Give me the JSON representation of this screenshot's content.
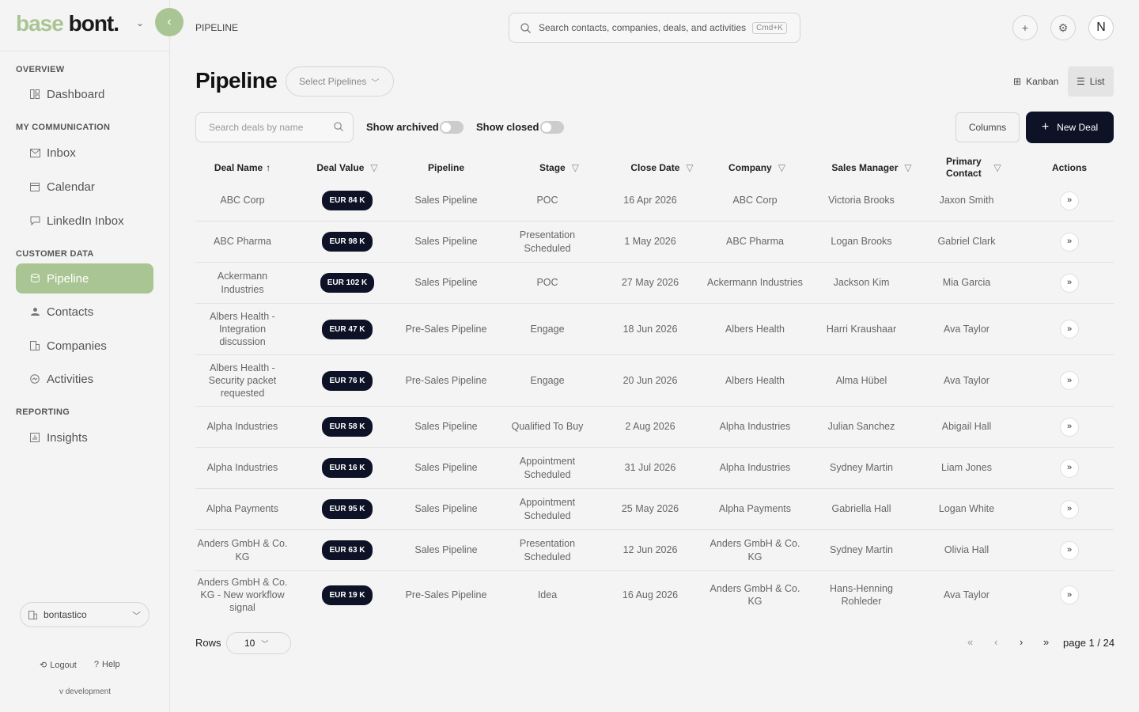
{
  "logo": {
    "part1": "base",
    "part2": "bont."
  },
  "breadcrumb": "PIPELINE",
  "top_search": {
    "placeholder": "Search contacts, companies, deals, and activities",
    "shortcut": "Cmd+K"
  },
  "user_initial": "N",
  "sidebar": {
    "sections": [
      {
        "title": "OVERVIEW",
        "items": [
          {
            "label": "Dashboard",
            "icon": "dashboard-icon"
          }
        ]
      },
      {
        "title": "MY COMMUNICATION",
        "items": [
          {
            "label": "Inbox",
            "icon": "mail-icon"
          },
          {
            "label": "Calendar",
            "icon": "calendar-icon"
          },
          {
            "label": "LinkedIn Inbox",
            "icon": "chat-icon"
          }
        ]
      },
      {
        "title": "CUSTOMER DATA",
        "items": [
          {
            "label": "Pipeline",
            "icon": "database-icon",
            "active": true
          },
          {
            "label": "Contacts",
            "icon": "people-icon"
          },
          {
            "label": "Companies",
            "icon": "building-icon"
          },
          {
            "label": "Activities",
            "icon": "activity-icon"
          }
        ]
      },
      {
        "title": "REPORTING",
        "items": [
          {
            "label": "Insights",
            "icon": "chart-icon"
          }
        ]
      }
    ],
    "workspace": "bontastico",
    "logout": "Logout",
    "help": "Help",
    "version": "v development"
  },
  "page": {
    "title": "Pipeline",
    "select_pipelines": "Select Pipelines",
    "views": {
      "kanban": "Kanban",
      "list": "List",
      "active": "List"
    }
  },
  "filters": {
    "search_placeholder": "Search deals by name",
    "show_archived": "Show archived",
    "show_closed": "Show closed",
    "columns": "Columns",
    "new_deal": "New Deal"
  },
  "table": {
    "headers": [
      "Deal Name",
      "Deal Value",
      "Pipeline",
      "Stage",
      "Close Date",
      "Company",
      "Sales Manager",
      "Primary Contact",
      "Actions"
    ],
    "rows": [
      {
        "name": "ABC Corp",
        "value": "EUR 84 K",
        "pipeline": "Sales Pipeline",
        "stage": "POC",
        "close": "16 Apr 2026",
        "company": "ABC Corp",
        "manager": "Victoria Brooks",
        "contact": "Jaxon Smith"
      },
      {
        "name": "ABC Pharma",
        "value": "EUR 98 K",
        "pipeline": "Sales Pipeline",
        "stage": "Presentation Scheduled",
        "close": "1 May 2026",
        "company": "ABC Pharma",
        "manager": "Logan Brooks",
        "contact": "Gabriel Clark"
      },
      {
        "name": "Ackermann Industries",
        "value": "EUR 102 K",
        "pipeline": "Sales Pipeline",
        "stage": "POC",
        "close": "27 May 2026",
        "company": "Ackermann Industries",
        "manager": "Jackson Kim",
        "contact": "Mia Garcia"
      },
      {
        "name": "Albers Health - Integration discussion",
        "value": "EUR 47 K",
        "pipeline": "Pre-Sales Pipeline",
        "stage": "Engage",
        "close": "18 Jun 2026",
        "company": "Albers Health",
        "manager": "Harri Kraushaar",
        "contact": "Ava Taylor"
      },
      {
        "name": "Albers Health - Security packet requested",
        "value": "EUR 76 K",
        "pipeline": "Pre-Sales Pipeline",
        "stage": "Engage",
        "close": "20 Jun 2026",
        "company": "Albers Health",
        "manager": "Alma Hübel",
        "contact": "Ava Taylor"
      },
      {
        "name": "Alpha Industries",
        "value": "EUR 58 K",
        "pipeline": "Sales Pipeline",
        "stage": "Qualified To Buy",
        "close": "2 Aug 2026",
        "company": "Alpha Industries",
        "manager": "Julian Sanchez",
        "contact": "Abigail Hall"
      },
      {
        "name": "Alpha Industries",
        "value": "EUR 16 K",
        "pipeline": "Sales Pipeline",
        "stage": "Appointment Scheduled",
        "close": "31 Jul 2026",
        "company": "Alpha Industries",
        "manager": "Sydney Martin",
        "contact": "Liam Jones"
      },
      {
        "name": "Alpha Payments",
        "value": "EUR 95 K",
        "pipeline": "Sales Pipeline",
        "stage": "Appointment Scheduled",
        "close": "25 May 2026",
        "company": "Alpha Payments",
        "manager": "Gabriella Hall",
        "contact": "Logan White"
      },
      {
        "name": "Anders GmbH & Co. KG",
        "value": "EUR 63 K",
        "pipeline": "Sales Pipeline",
        "stage": "Presentation Scheduled",
        "close": "12 Jun 2026",
        "company": "Anders GmbH & Co. KG",
        "manager": "Sydney Martin",
        "contact": "Olivia Hall"
      },
      {
        "name": "Anders GmbH & Co. KG - New workflow signal",
        "value": "EUR 19 K",
        "pipeline": "Pre-Sales Pipeline",
        "stage": "Idea",
        "close": "16 Aug 2026",
        "company": "Anders GmbH & Co. KG",
        "manager": "Hans-Henning Rohleder",
        "contact": "Ava Taylor"
      }
    ]
  },
  "pagination": {
    "rows_label": "Rows",
    "rows_value": "10",
    "page_info": "page 1 / 24"
  },
  "colors": {
    "accent": "#a9c593",
    "primary_dark": "#0d1226"
  }
}
